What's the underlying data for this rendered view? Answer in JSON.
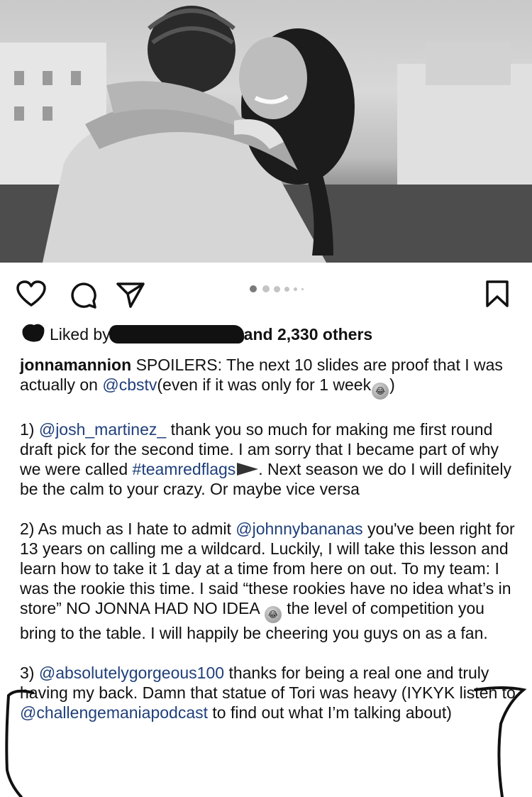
{
  "actions": {
    "like_icon": "heart-icon",
    "comment_icon": "comment-icon",
    "share_icon": "send-icon",
    "save_icon": "bookmark-icon",
    "carousel_current": 1,
    "carousel_total": 11
  },
  "likes": {
    "prefix": "Liked by",
    "suffix": "and 2,330 others"
  },
  "caption": {
    "username": "jonnamannion",
    "p0": {
      "t1": "SPOILERS: The next 10 slides are proof that I was actually on",
      "mention": "@cbstv",
      "t2": "(even if it was only for 1 week",
      "t3": ")"
    },
    "p1": {
      "t1": "1)",
      "mention": "@josh_martinez_",
      "t2": "thank you so much for making me first round draft pick for the second time. I am sorry that I became part of why we were called",
      "hashtag": "#teamredflags",
      "t3": ". Next season we do I will definitely be the calm to your crazy. Or maybe vice versa"
    },
    "p2": {
      "t1": "2) As much as I hate to admit",
      "mention": "@johnnybananas",
      "t2": "you've been right for 13 years on calling me a wildcard. Luckily, I will take this lesson and learn how to take it 1 day at a time from here on out. To my team: I was the rookie this time. I said “these rookies have no idea what’s in store” NO JONNA HAD NO IDEA",
      "t3": "the level of competition you bring to the table. I will happily be cheering you guys on as a fan."
    },
    "p3": {
      "t1": "3)",
      "mention": "@absolutelygorgeous100",
      "t2": "thanks for being a real one and truly having my back. Damn that statue of Tori was heavy (IYKYK listen to",
      "mention2": "@challengemaniapodcast",
      "t3": "to find out what I’m talking about)"
    }
  }
}
